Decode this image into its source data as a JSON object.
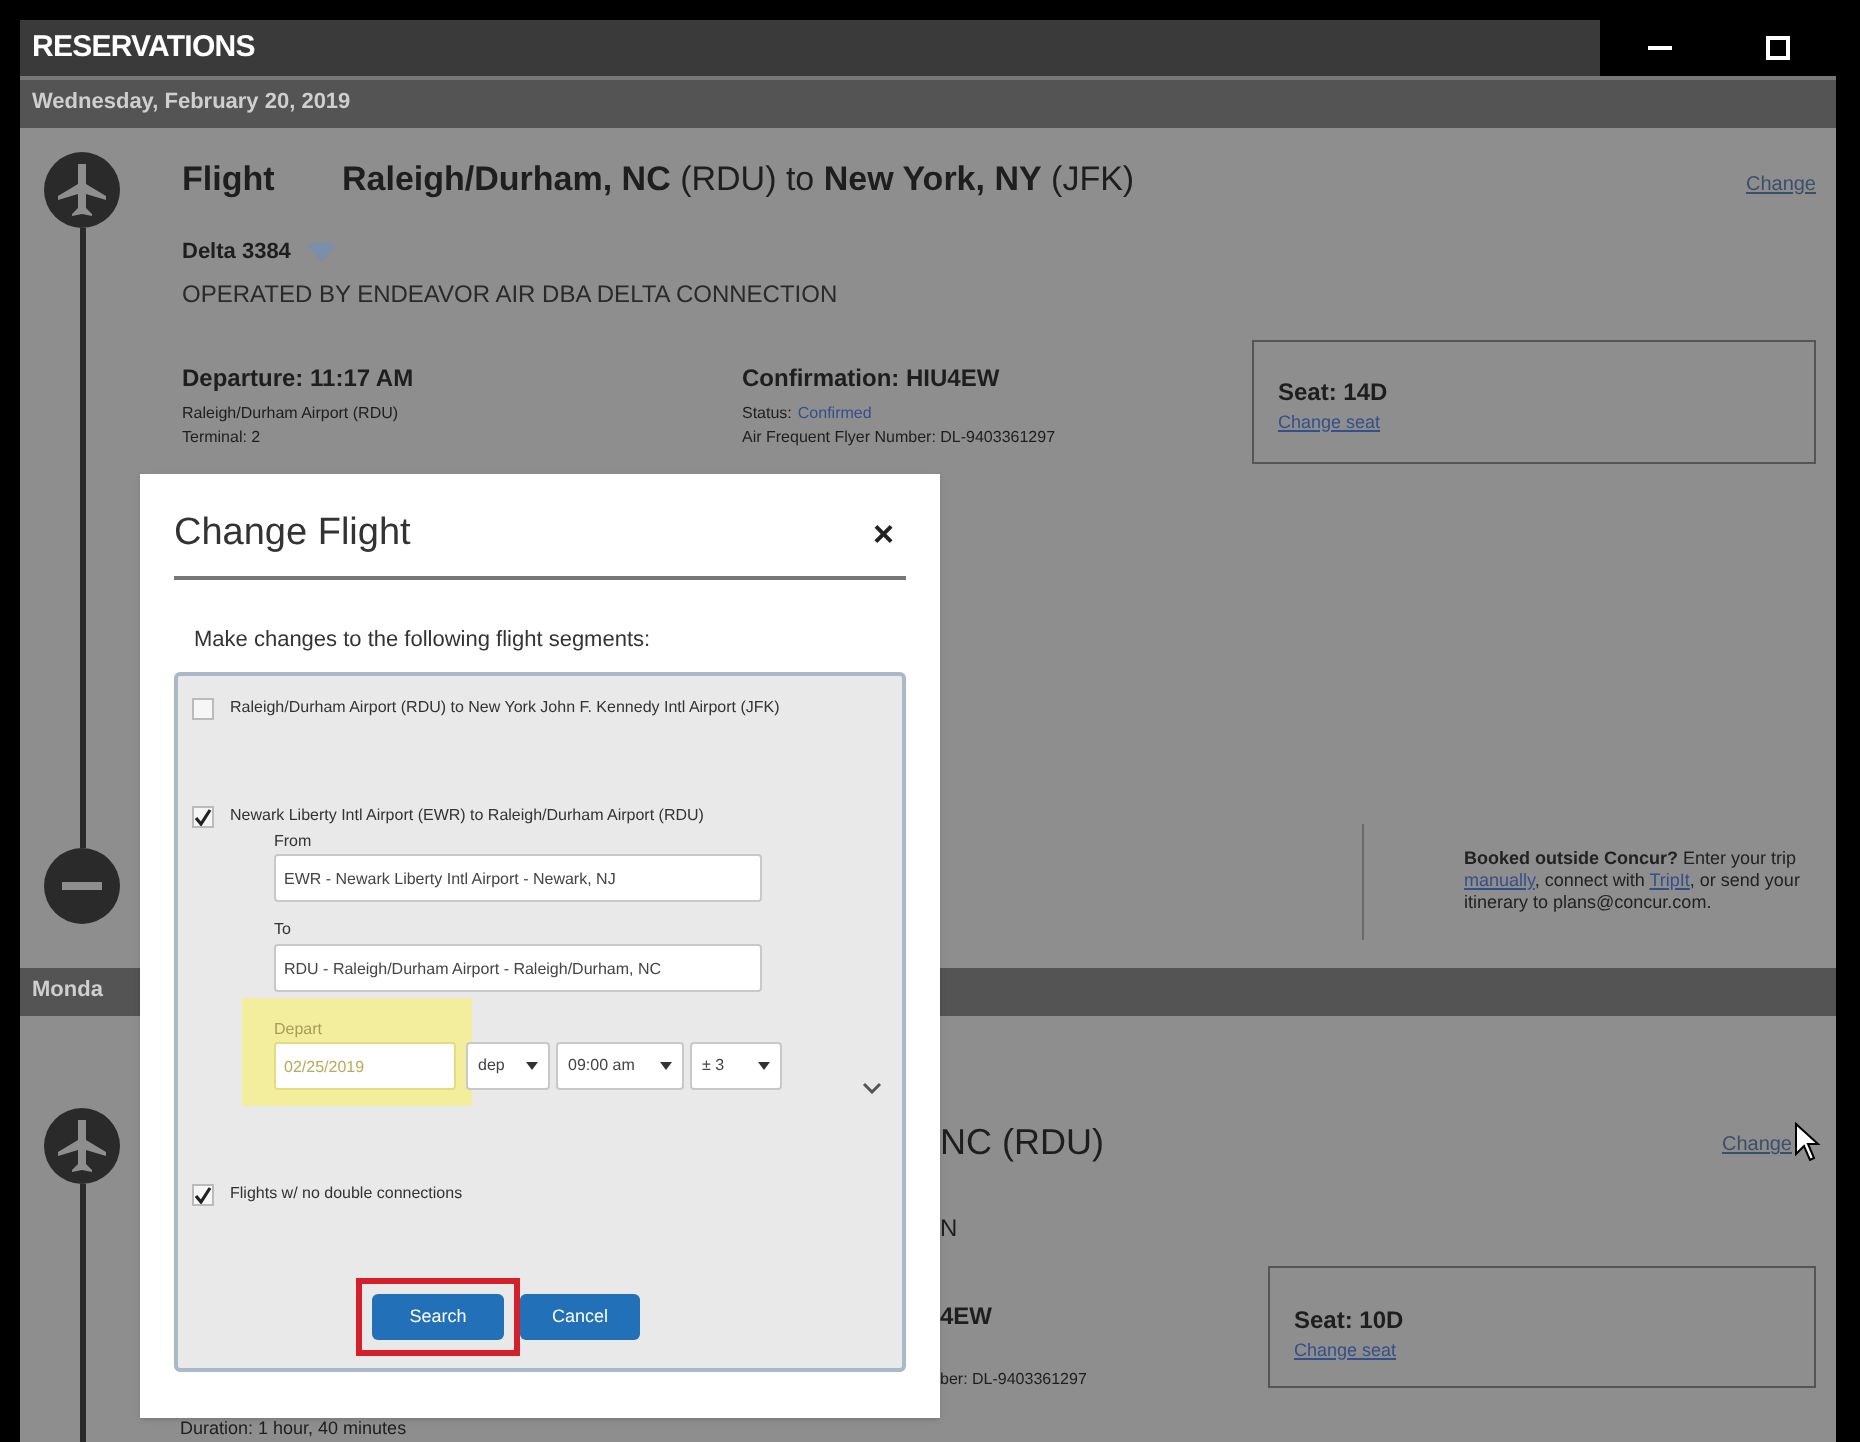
{
  "window": {
    "title": "RESERVATIONS"
  },
  "day_1": {
    "date": "Wednesday, February 20, 2019",
    "flight": {
      "label": "Flight",
      "route": "**Raleigh/Durham, NC** (RDU) to **New York, NY** (JFK)",
      "change_link": "Change",
      "flight_number": "Delta 3384",
      "operated_by": "OPERATED BY ENDEAVOR AIR DBA DELTA CONNECTION",
      "departure": "Departure: 11:17 AM",
      "airport": "Raleigh/Durham Airport (RDU)",
      "terminal": "Terminal: 2",
      "confirmation": "Confirmation: HIU4EW",
      "status_label": "Status:",
      "status": "Confirmed",
      "frequent_flyer": "Air Frequent Flyer Number: DL-9403361297",
      "seat": "Seat: 14D",
      "change_seat": "Change seat"
    },
    "booked_outside": {
      "lead": "**Booked outside Concur?** Enter your trip",
      "link_1": "manually",
      "middle": ", connect with",
      "link_2": "TripIt",
      "tail": ", or send your itinerary to plans@concur.com."
    }
  },
  "day_2": {
    "date": "Monda",
    "flight": {
      "route": "NC (RDU)",
      "operated_by": "N",
      "confirmation": "4EW",
      "frequent_flyer": "ber: DL-9403361297",
      "seat": "Seat: 10D",
      "change_seat": "Change seat",
      "change_link": "Change",
      "duration": "Duration: 1 hour, 40 minutes"
    }
  },
  "dialog": {
    "title": "Change Flight",
    "close": "×",
    "instructions": "Make changes to the following flight segments:",
    "segments": [
      {
        "label": "Raleigh/Durham Airport (RDU) to New York John F. Kennedy Intl Airport (JFK)",
        "checked": false
      },
      {
        "label": "Newark Liberty Intl Airport (EWR) to Raleigh/Durham Airport (RDU)",
        "checked": true,
        "from_label": "From",
        "from_value": "EWR - Newark Liberty Intl Airport - Newark, NJ",
        "to_label": "To",
        "to_value": "RDU - Raleigh/Durham Airport - Raleigh/Durham, NC",
        "depart_label": "Depart",
        "depart_value": "02/25/2019",
        "depart_highlighted": true,
        "selects": [
          "dep",
          "09:00 am",
          "± 3"
        ]
      }
    ],
    "option": {
      "label": "Flights w/ no double connections",
      "checked": true
    },
    "buttons": [
      {
        "label": "Search",
        "highlighted": true
      },
      {
        "label": "Cancel",
        "highlighted": false
      }
    ]
  }
}
